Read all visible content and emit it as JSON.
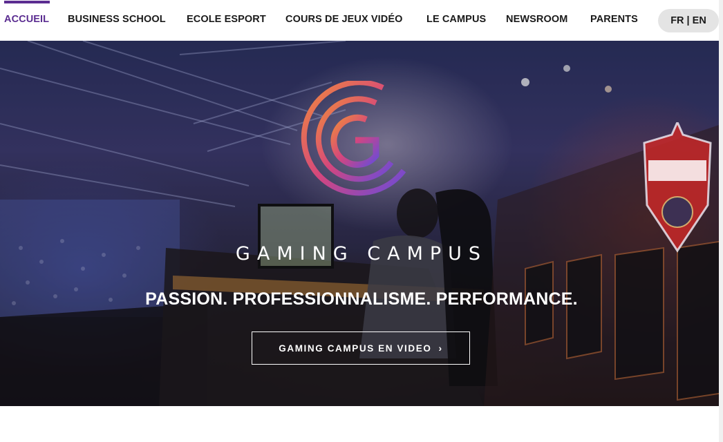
{
  "nav": {
    "items": [
      {
        "label": "ACCUEIL",
        "active": true
      },
      {
        "label": "BUSINESS SCHOOL"
      },
      {
        "label": "ECOLE ESPORT"
      },
      {
        "label": "COURS DE JEUX VIDÉO"
      },
      {
        "label": "LE CAMPUS"
      },
      {
        "label": "NEWSROOM"
      },
      {
        "label": "PARENTS"
      }
    ],
    "language_toggle": "FR | EN"
  },
  "hero": {
    "brand_title": "GAMING CAMPUS",
    "tagline": "PASSION. PROFESSIONNALISME. PERFORMANCE.",
    "video_button": "GAMING CAMPUS EN VIDEO",
    "button_icon": "chevron-right-icon",
    "logo_letter": "G",
    "background_image": "esports arena with player at gaming station"
  },
  "colors": {
    "accent": "#5b2d91",
    "logo_orange": "#f08a3c",
    "logo_pink": "#d5467d",
    "logo_purple": "#6a4bd8"
  }
}
